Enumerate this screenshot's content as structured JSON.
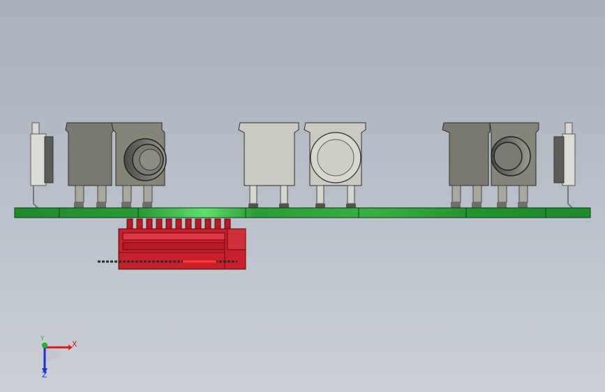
{
  "viewport": {
    "background_top": "#a9b0bc",
    "background_bottom": "#cbd0d6"
  },
  "colors": {
    "pcb": "#1f8a2e",
    "pcb_highlight": "#5fe06a",
    "connector_red": "#c8202a",
    "switch_light": "#c9c8c0",
    "switch_dark": "#73726c",
    "axis_x": "#e01818",
    "axis_y": "#22b030",
    "axis_z": "#2030d0"
  },
  "triad": {
    "x_label": "X",
    "y_label": "Y",
    "z_label": "Z"
  },
  "icons": [
    "coordinate-triad-icon"
  ]
}
